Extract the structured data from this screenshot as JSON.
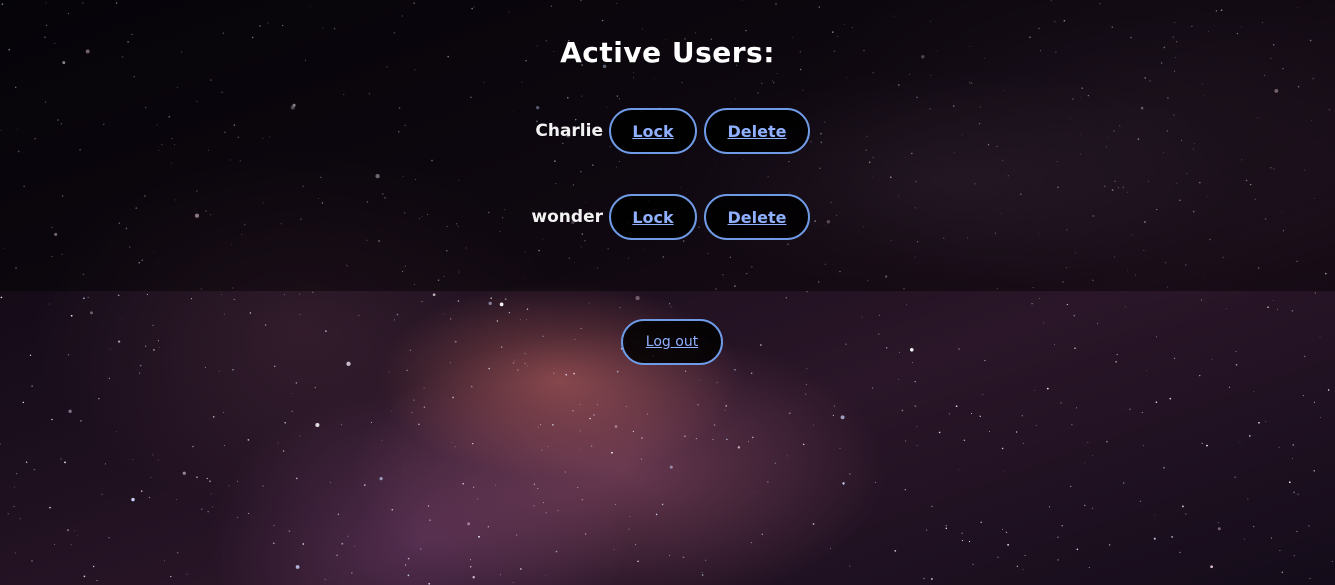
{
  "page": {
    "title": "Active Users:"
  },
  "users": [
    {
      "name": "Charlie",
      "lock_label": "Lock",
      "delete_label": "Delete"
    },
    {
      "name": "wonder",
      "lock_label": "Lock",
      "delete_label": "Delete"
    }
  ],
  "logout_label": "Log out",
  "colors": {
    "button_border": "#6f9be6",
    "button_text": "#8fb0ff",
    "title_text": "#ffffff"
  }
}
